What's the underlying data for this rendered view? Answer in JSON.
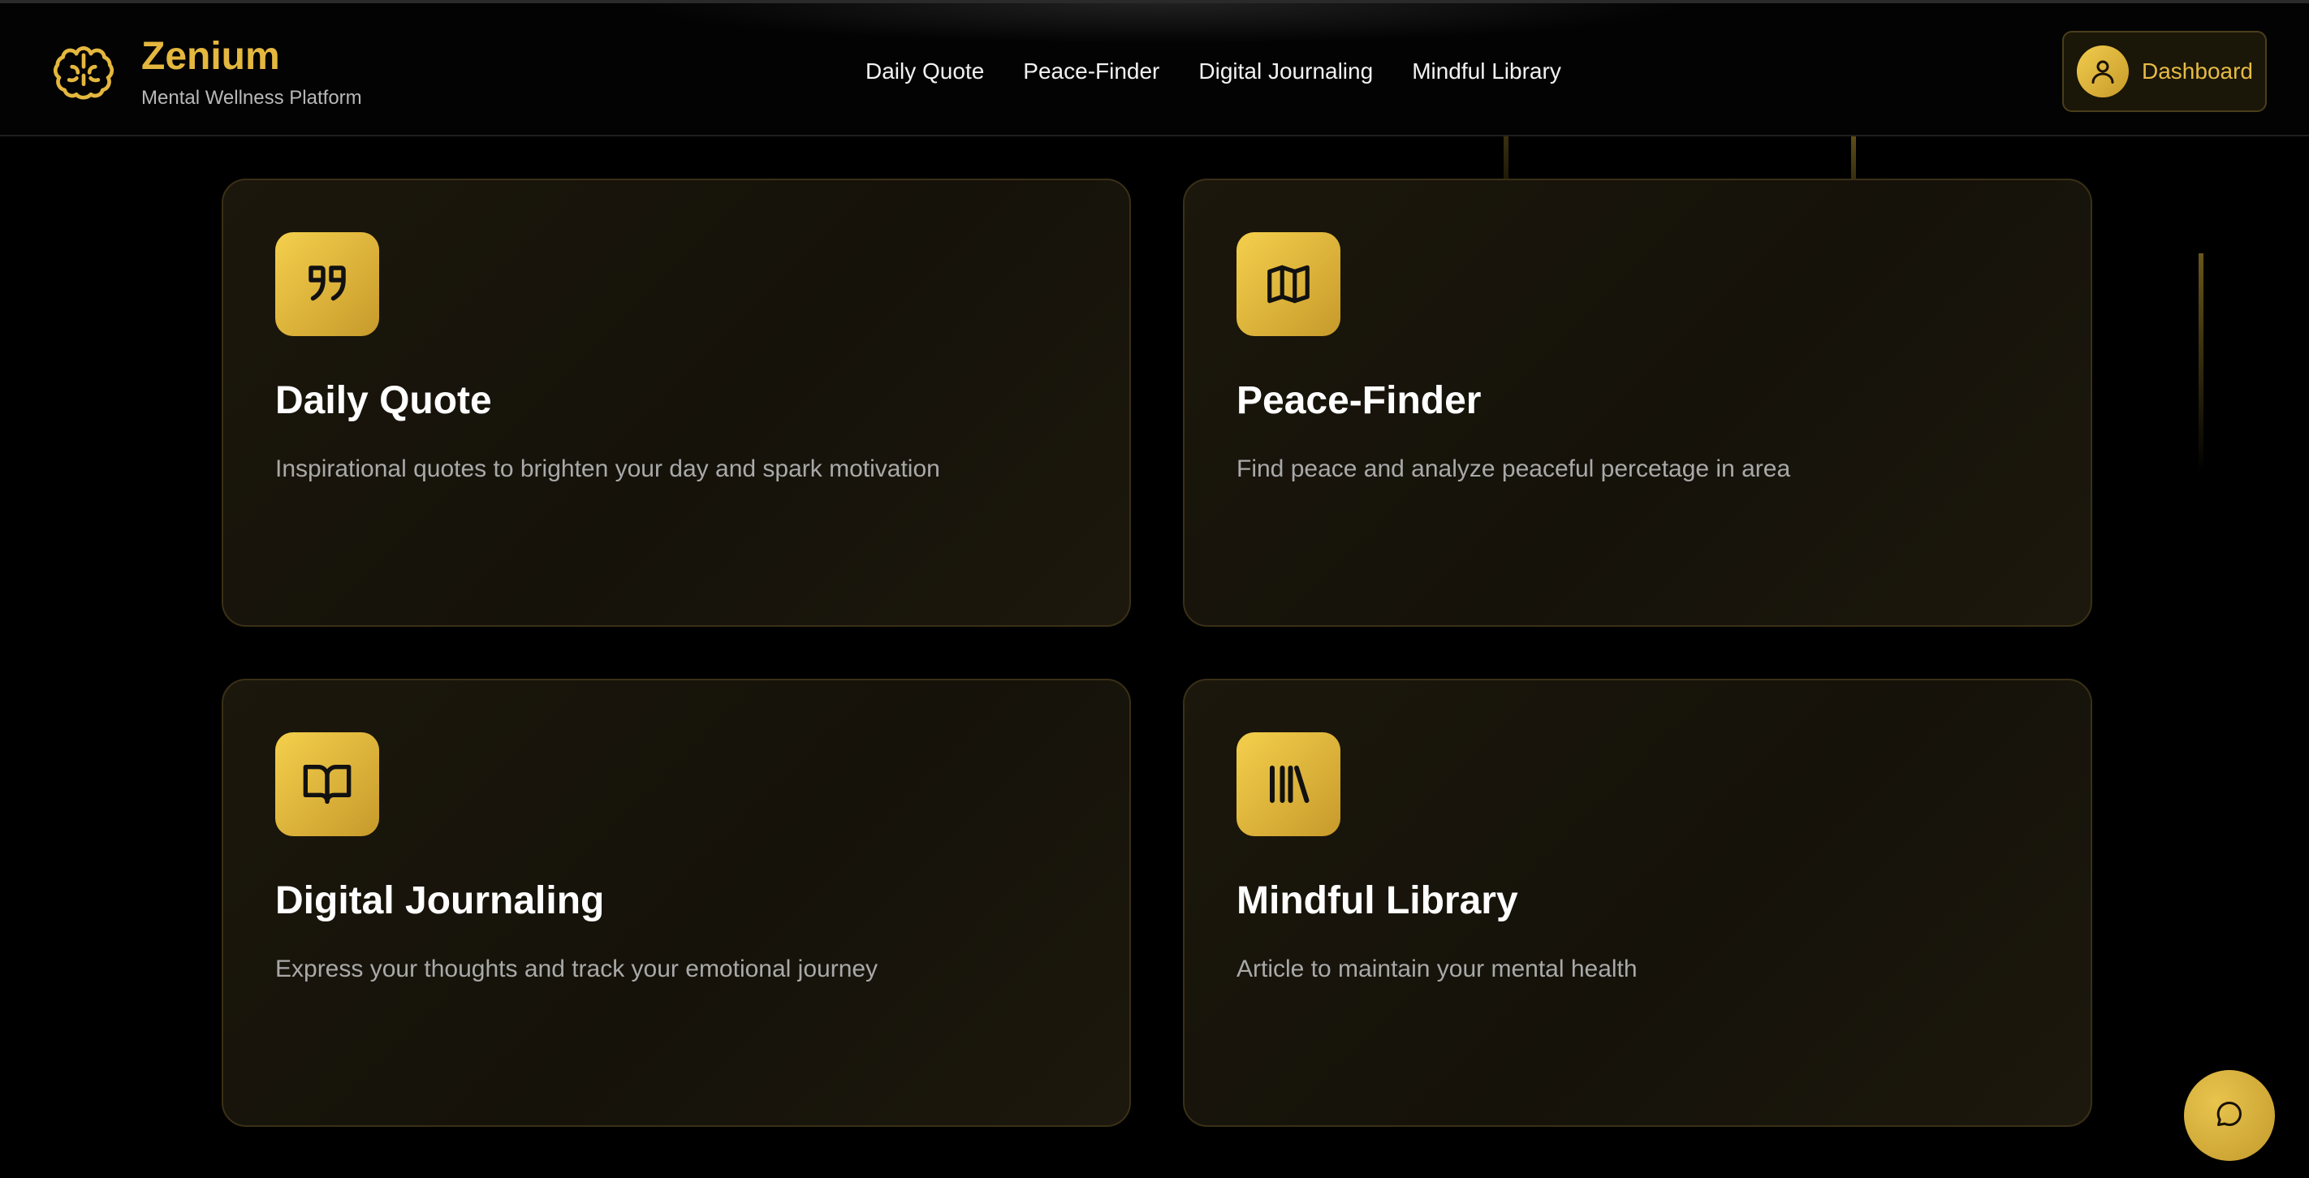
{
  "brand": {
    "title": "Zenium",
    "subtitle": "Mental Wellness Platform",
    "icon": "brain-icon"
  },
  "nav": {
    "items": [
      {
        "label": "Daily Quote"
      },
      {
        "label": "Peace-Finder"
      },
      {
        "label": "Digital Journaling"
      },
      {
        "label": "Mindful Library"
      }
    ]
  },
  "dashboard": {
    "label": "Dashboard",
    "icon": "user-icon"
  },
  "cards": [
    {
      "title": "Daily Quote",
      "description": "Inspirational quotes to brighten your day and spark motivation",
      "icon": "quote-icon"
    },
    {
      "title": "Peace-Finder",
      "description": "Find peace and analyze peaceful percetage in area",
      "icon": "map-icon"
    },
    {
      "title": "Digital Journaling",
      "description": "Express your thoughts and track your emotional journey",
      "icon": "book-open-icon"
    },
    {
      "title": "Mindful Library",
      "description": "Article to maintain your mental health",
      "icon": "library-icon"
    }
  ],
  "chat": {
    "icon": "chat-bubble-icon"
  },
  "colors": {
    "accent": "#e4b73e",
    "background": "#000000",
    "card_background": "#1b170c",
    "card_border": "#3a3016",
    "text_primary": "#ffffff",
    "text_secondary": "#a9a9a9"
  }
}
